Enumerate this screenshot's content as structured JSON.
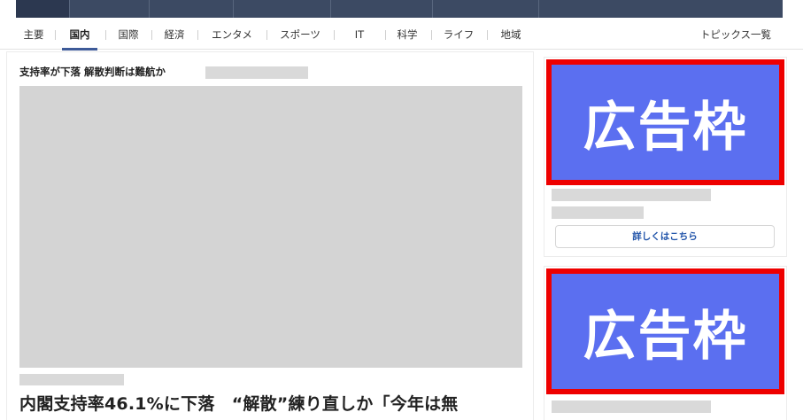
{
  "categories": [
    "主要",
    "国内",
    "国際",
    "経済",
    "エンタメ",
    "スポーツ",
    "IT",
    "科学",
    "ライフ",
    "地域"
  ],
  "active_category_index": 1,
  "topics_link": "トピックス一覧",
  "main": {
    "small_headline": "支持率が下落 解散判断は難航か",
    "big_headline": "内閣支持率46.1%に下落　“解散”練り直しか「今年は無"
  },
  "sidebar": {
    "ad_label": "広告枠",
    "more_button": "詳しくはこちら"
  },
  "colors": {
    "topbar": "#3c4a63",
    "active_underline": "#3d5a98",
    "ad_fill": "#5b6ff0",
    "ad_border": "#ee0000",
    "placeholder": "#d9d9d9"
  }
}
